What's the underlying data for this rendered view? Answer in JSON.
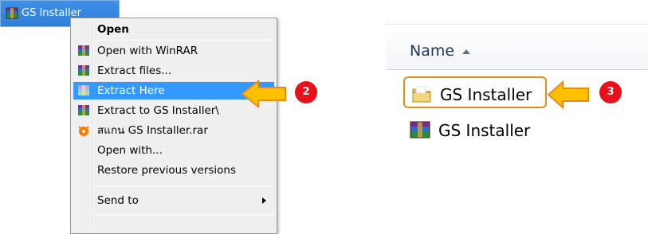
{
  "desktop_file": {
    "name": "GS Installer",
    "icon": "winrar-archive-icon"
  },
  "context_menu": {
    "items": [
      {
        "label": "Open",
        "icon": "",
        "bold": true
      },
      {
        "label": "Open with WinRAR",
        "icon": "winrar-icon"
      },
      {
        "label": "Extract files...",
        "icon": "winrar-icon"
      },
      {
        "label": "Extract Here",
        "icon": "winrar-icon",
        "highlighted": true
      },
      {
        "label": "Extract to GS Installer\\",
        "icon": "winrar-icon"
      },
      {
        "label": "สแกน GS Installer.rar",
        "icon": "avast-icon"
      },
      {
        "label": "Open with...",
        "icon": ""
      },
      {
        "label": "Restore previous versions",
        "icon": ""
      },
      {
        "label": "Send to",
        "icon": "",
        "submenu": true
      }
    ]
  },
  "explorer": {
    "column_header": "Name",
    "sort": "ascending",
    "rows": [
      {
        "name": "GS Installer",
        "type": "folder",
        "icon": "folder-icon"
      },
      {
        "name": "GS Installer",
        "type": "archive",
        "icon": "winrar-archive-icon"
      }
    ]
  },
  "annotations": [
    {
      "step": "2",
      "color": "#e8111a"
    },
    {
      "step": "3",
      "color": "#e8111a"
    }
  ],
  "colors": {
    "highlight": "#3399ff",
    "arrow_fill": "#ffc000",
    "outline": "#e68a1c",
    "badge": "#e8111a"
  }
}
